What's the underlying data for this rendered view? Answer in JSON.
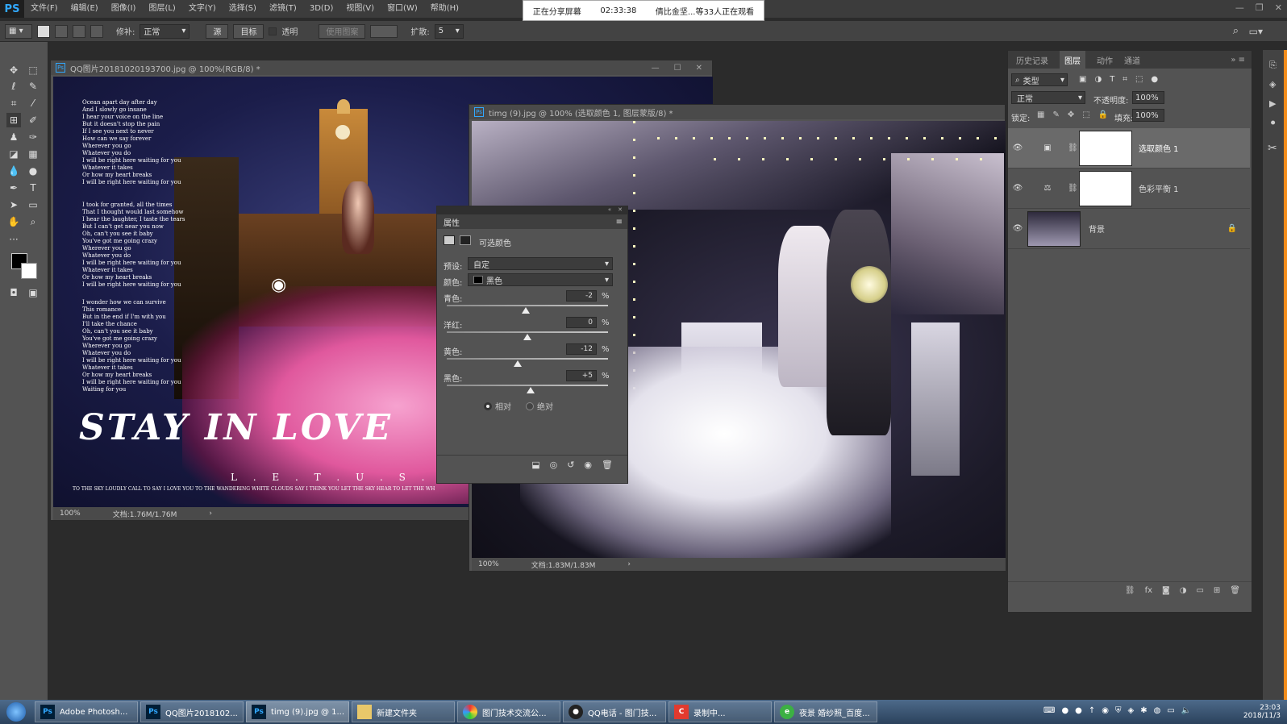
{
  "app": {
    "logo": "PS",
    "menu": [
      "文件(F)",
      "编辑(E)",
      "图像(I)",
      "图层(L)",
      "文字(Y)",
      "选择(S)",
      "滤镜(T)",
      "3D(D)",
      "视图(V)",
      "窗口(W)",
      "帮助(H)"
    ]
  },
  "share_banner": {
    "status": "正在分享屏幕",
    "timer": "02:33:38",
    "viewers": "倩比金坚...等33人正在观看"
  },
  "options_bar": {
    "patch_label": "修补:",
    "patch_mode": "正常",
    "source_btn": "源",
    "target_btn": "目标",
    "transparent_label": "透明",
    "use_pattern_btn": "使用图案",
    "diffuse_label": "扩散:",
    "diffuse_value": "5"
  },
  "doc1": {
    "title": "QQ图片20181020193700.jpg @ 100%(RGB/8) *",
    "zoom": "100%",
    "doc_size": "文档:1.76M/1.76M",
    "poster": {
      "poem1": "Ocean apart day after day\nAnd I slowly go insane\nI hear your voice on the line\nBut it doesn't stop the pain\nIf I see you next to never\nHow can we say forever\nWherever you go\nWhatever you do\nI will be right here waiting for you\nWhatever it takes\nOr how my heart breaks\nI will be right here waiting for you",
      "poem2": "I took for granted, all the times\nThat I thought would last somehow\nI hear the laughter, I taste the tears\nBut I can't get near you now\nOh, can't you see it baby\nYou've got me going crazy\nWherever you go\nWhatever you do\nI will be right here waiting for you\nWhatever it takes\nOr how my heart breaks\nI will be right here waiting for you",
      "poem3": "I wonder how we can survive\nThis romance\nBut in the end if I'm with you\nI'll take the chance\nOh, can't you see it baby\nYou've got me going crazy\nWherever you go\nWhatever you do\nI will be right here waiting for you\nWhatever it takes\nOr how my heart breaks\nI will be right here waiting for you\nWaiting for you",
      "headline": "STAY IN LOVE",
      "spaced": "L . E . T . U . S . D . O . I",
      "footer": "TO THE SKY LOUDLY CALL TO SAY I LOVE YOU TO THE WANDERING WHITE CLOUDS SAY I THINK YOU LET THE SKY HEAR TO LET THE WH"
    }
  },
  "doc2": {
    "title": "timg (9).jpg @ 100% (选取颜色 1, 图层蒙版/8) *",
    "zoom": "100%",
    "doc_size": "文档:1.83M/1.83M"
  },
  "properties": {
    "tab": "属性",
    "adjustment": "可选颜色",
    "preset_label": "预设:",
    "preset_value": "自定",
    "colors_label": "颜色:",
    "colors_value": "黑色",
    "sliders": [
      {
        "label": "青色:",
        "value": "-2",
        "pct": 0.49
      },
      {
        "label": "洋红:",
        "value": "0",
        "pct": 0.5
      },
      {
        "label": "黄色:",
        "value": "-12",
        "pct": 0.44
      },
      {
        "label": "黑色:",
        "value": "+5",
        "pct": 0.52
      }
    ],
    "unit": "%",
    "radio_relative": "相对",
    "radio_absolute": "绝对"
  },
  "layers_panel": {
    "tabs": [
      "历史记录",
      "图层",
      "动作",
      "通道"
    ],
    "filter_label": "类型",
    "blend_mode": "正常",
    "opacity_label": "不透明度:",
    "opacity_value": "100%",
    "lock_label": "锁定:",
    "fill_label": "填充:",
    "fill_value": "100%",
    "layers": [
      {
        "name": "选取颜色 1"
      },
      {
        "name": "色彩平衡 1"
      },
      {
        "name": "背景"
      }
    ]
  },
  "taskbar": {
    "items": [
      {
        "label": "Adobe Photosh...",
        "icon": "Ps"
      },
      {
        "label": "QQ图片2018102...",
        "icon": "Ps"
      },
      {
        "label": "timg (9).jpg @ 1...",
        "icon": "Ps"
      },
      {
        "label": "新建文件夹",
        "icon": "folder"
      },
      {
        "label": "图门技术交流公...",
        "icon": "qq-group"
      },
      {
        "label": "QQ电话 - 图门技...",
        "icon": "qq"
      },
      {
        "label": "录制中...",
        "icon": "record"
      },
      {
        "label": "夜景 婚纱照_百度...",
        "icon": "browser"
      }
    ],
    "time": "23:03",
    "date": "2018/11/3"
  }
}
